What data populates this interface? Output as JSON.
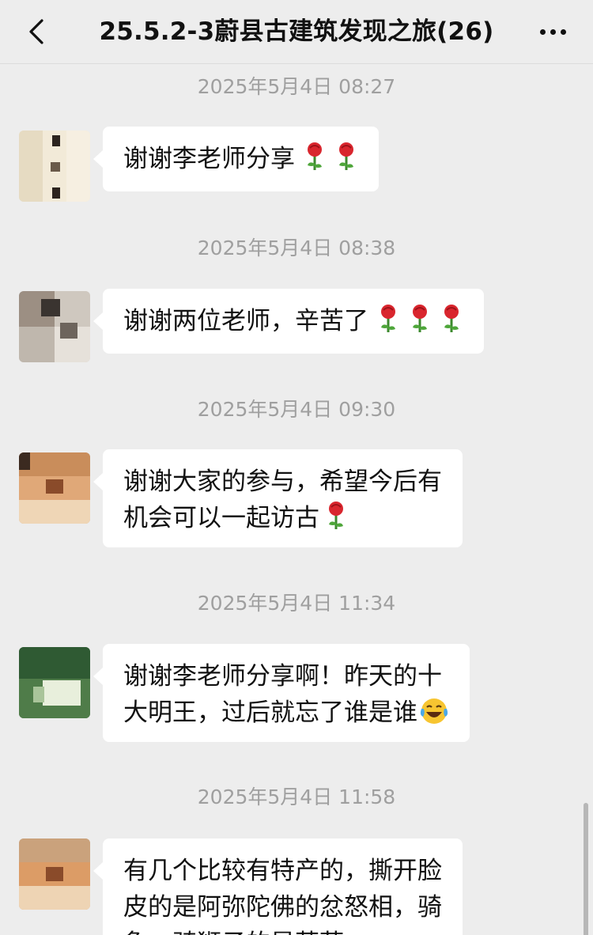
{
  "header": {
    "back_icon": "chevron-left-icon",
    "title": "25.5.2-3蔚县古建筑发现之旅(26)",
    "more_icon": "ellipsis-icon"
  },
  "messages": [
    {
      "timestamp": "2025年5月4日 08:27",
      "text": "谢谢李老师分享",
      "emoji": [
        "rose",
        "rose"
      ]
    },
    {
      "timestamp": "2025年5月4日 08:38",
      "text": "谢谢两位老师，辛苦了",
      "emoji": [
        "rose",
        "rose",
        "rose"
      ]
    },
    {
      "timestamp": "2025年5月4日 09:30",
      "line1": "谢谢大家的参与，希望今后有",
      "line2": "机会可以一起访古",
      "emoji": [
        "rose"
      ]
    },
    {
      "timestamp": "2025年5月4日 11:34",
      "line1": "谢谢李老师分享啊！昨天的十",
      "line2": "大明王，过后就忘了谁是谁",
      "emoji": [
        "laughing-crying"
      ]
    },
    {
      "timestamp": "2025年5月4日 11:58",
      "line1": "有几个比较有特产的，撕开脸",
      "line2": "皮的是阿弥陀佛的忿怒相，骑",
      "line3": "象、骑狮子的是菩萨…"
    }
  ],
  "colors": {
    "background": "#ededed",
    "bubble": "#ffffff",
    "timestamp": "#9f9f9f",
    "rose": "#d9262e"
  }
}
